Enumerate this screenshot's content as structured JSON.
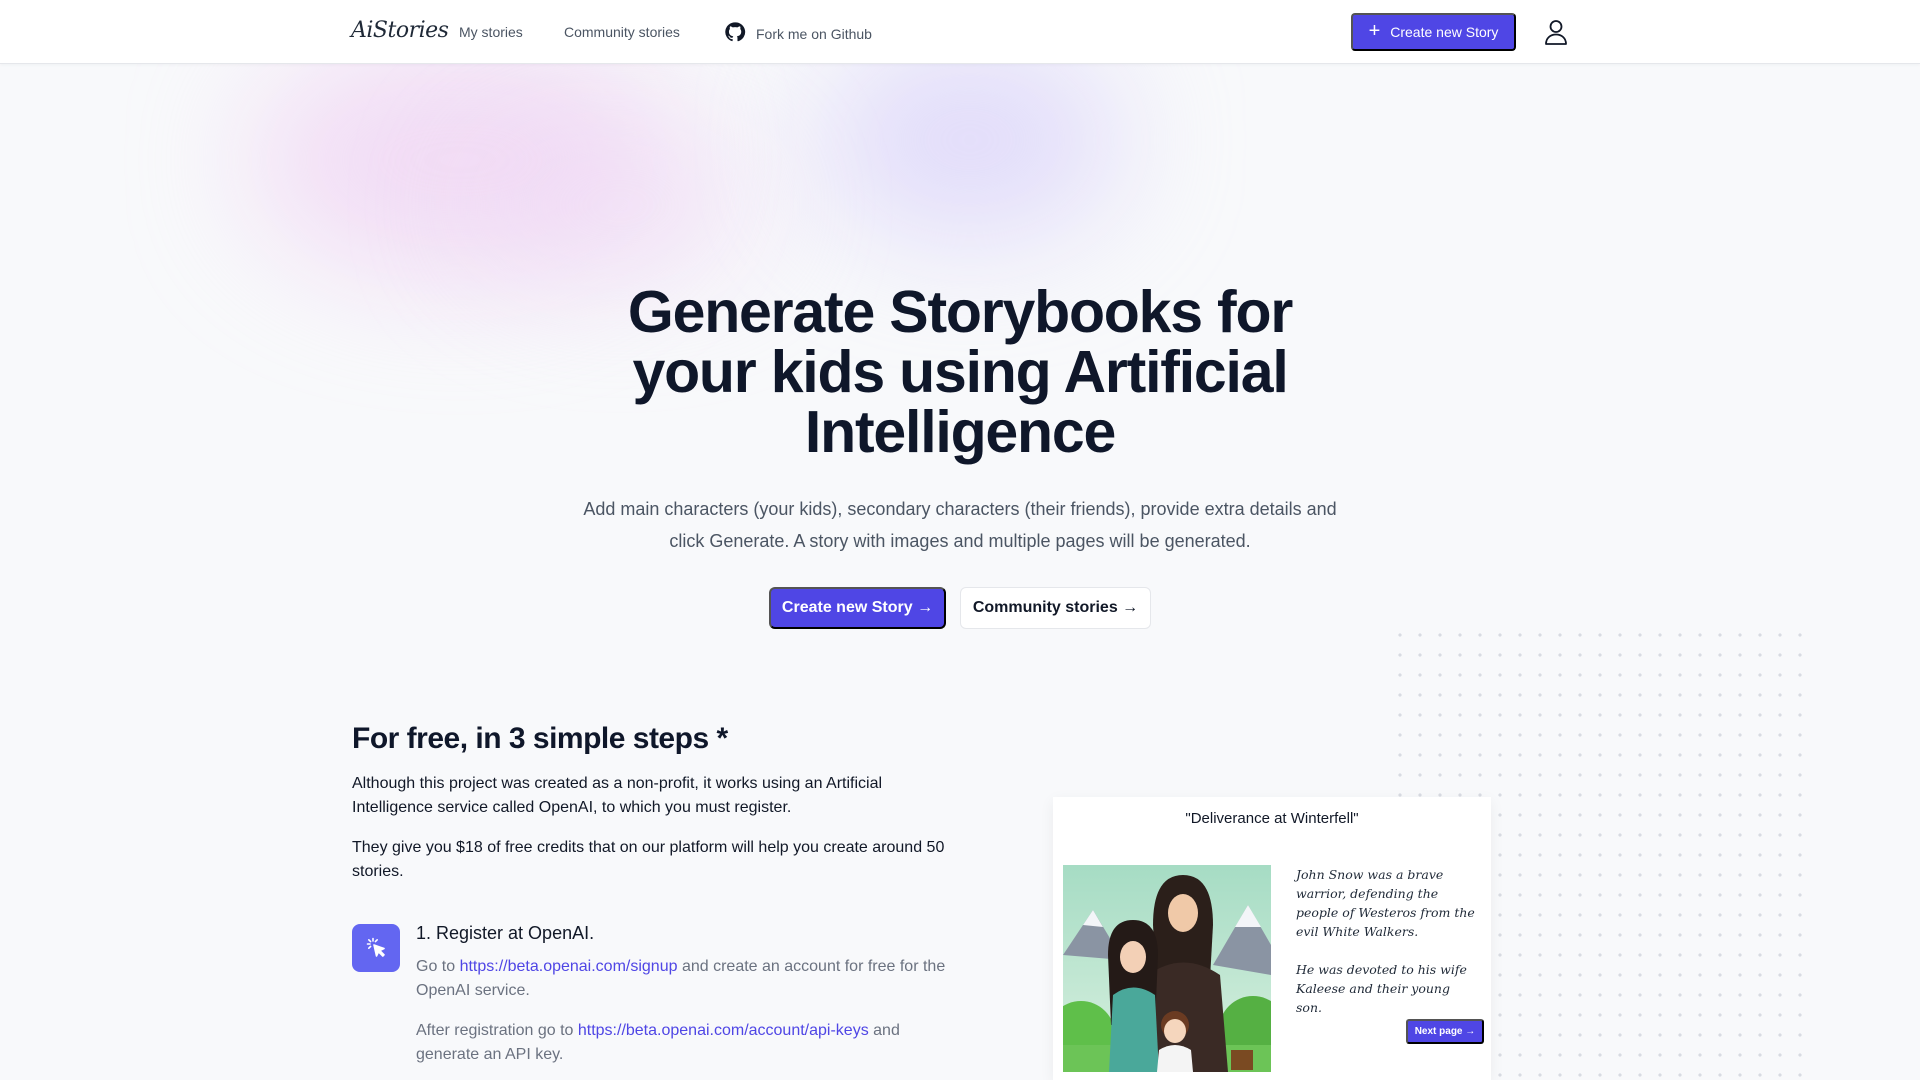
{
  "nav": {
    "logo": "AiStories",
    "links": [
      "My stories",
      "Community stories"
    ],
    "github_label": "Fork me on Github",
    "create_label": "Create new Story",
    "create_icon": "plus-icon",
    "user_icon": "user-icon"
  },
  "hero": {
    "title": "Generate Storybooks for your kids using Artificial Intelligence",
    "subtitle": "Add main characters (your kids), secondary characters (their friends), provide extra details and click Generate. A story with images and multiple pages will be generated.",
    "primary_button": "Create new Story →",
    "secondary_button": "Community stories →"
  },
  "steps": {
    "title": "For free, in 3 simple steps *",
    "intro_1": "Although this project was created as a non-profit, it works using an Artificial Intelligence service called OpenAI, to which you must register.",
    "intro_2": "They give you $18 of free credits that on our platform will help you create around 50 stories.",
    "step1": {
      "icon": "cursor-click-icon",
      "title": "1. Register at OpenAI.",
      "line1_prefix": "Go to ",
      "line1_link": "https://beta.openai.com/signup",
      "line1_suffix": " and create an account for free for the OpenAI service.",
      "line2_prefix": "After registration go to ",
      "line2_link": "https://beta.openai.com/account/api-keys",
      "line2_suffix": " and generate an API key."
    }
  },
  "preview": {
    "title": "\"Deliverance at Winterfell\"",
    "paragraph_1": "John Snow was a brave warrior, defending the people of Westeros from the evil White Walkers.",
    "paragraph_2": "He was devoted to his wife Kaleese and their young son.",
    "next_label": "Next page →"
  },
  "colors": {
    "accent": "#4f46e5",
    "icon_bg": "#6366f1",
    "background": "#f8f9fb"
  }
}
